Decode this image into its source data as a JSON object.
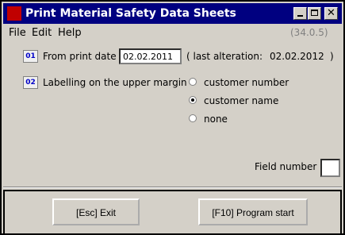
{
  "window": {
    "title": "Print Material Safety Data Sheets",
    "version": "(34.0.5)"
  },
  "menu": {
    "file_label": "File",
    "edit_label": "Edit",
    "help_label": "Help"
  },
  "fields": {
    "print_date_code": "01",
    "print_date_label": "From print date",
    "print_date_value": "02.02.2011",
    "last_alteration_prefix": "( last alteration:",
    "last_alteration_value": "02.02.2012",
    "last_alteration_suffix": ")",
    "labelling_code": "02",
    "labelling_label": "Labelling on the upper margin",
    "options": [
      "customer number",
      "customer name",
      "none"
    ],
    "selected_option": "customer name",
    "field_number_label": "Field number"
  },
  "buttons": {
    "exit_label": "[Esc] Exit",
    "start_label": "[F10] Program start"
  }
}
